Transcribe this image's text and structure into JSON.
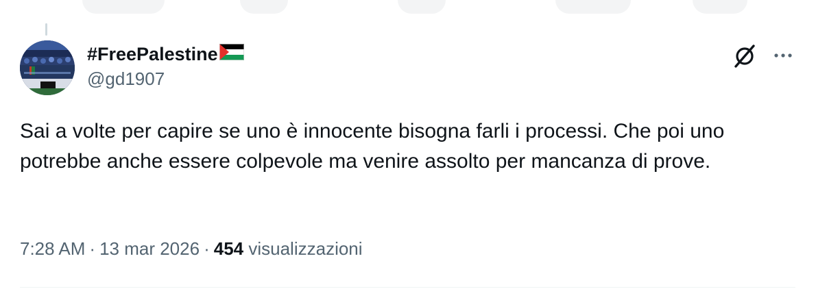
{
  "tweet": {
    "display_name": "#FreePalestine",
    "handle": "@gd1907",
    "text": "Sai a volte per capire se uno è innocente bisogna farli i processi. Che poi uno potrebbe anche essere colpevole ma venire assolto per mancanza di prove.",
    "time": "7:28 AM",
    "date": "13 mar 2026",
    "separator": "·",
    "views_count": "454",
    "views_label": "visualizzazioni"
  },
  "icons": {
    "flag": "palestine-flag-icon",
    "grok": "grok-icon",
    "more": "more-options-icon"
  },
  "colors": {
    "text_primary": "#0f1419",
    "text_secondary": "#536471",
    "flag_red": "#e4312b",
    "flag_green": "#149954",
    "flag_black": "#000000",
    "flag_white": "#ffffff"
  }
}
